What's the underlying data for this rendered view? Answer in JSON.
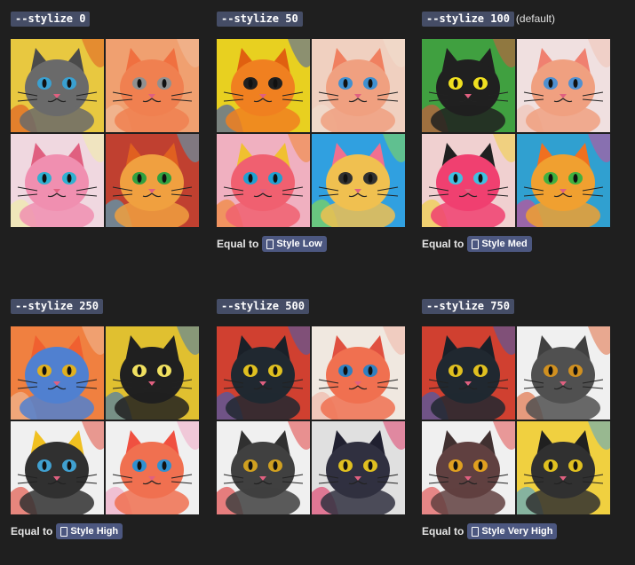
{
  "panels": [
    {
      "command": "--stylize 0",
      "note": "",
      "equal_prefix": "",
      "style": "",
      "palettes": [
        {
          "bg": "#e8c840",
          "face": "#6a6a6a",
          "ear": "#4a4a4a",
          "eye": "#3aa0d0",
          "accent": "#e05020"
        },
        {
          "bg": "#f0a070",
          "face": "#f08050",
          "ear": "#f07040",
          "eye": "#909090",
          "accent": "#f0c0a0"
        },
        {
          "bg": "#f0d8e0",
          "face": "#f08fb0",
          "ear": "#e06080",
          "eye": "#30b0d0",
          "accent": "#f0f0a0"
        },
        {
          "bg": "#c04030",
          "face": "#f0a040",
          "ear": "#e06020",
          "eye": "#30a040",
          "accent": "#40b0d0"
        }
      ]
    },
    {
      "command": "--stylize 50",
      "note": "",
      "equal_prefix": "Equal to",
      "style": "Style Low",
      "palettes": [
        {
          "bg": "#e8d020",
          "face": "#f08020",
          "ear": "#e06010",
          "eye": "#202020",
          "accent": "#3050c0"
        },
        {
          "bg": "#f0d0c0",
          "face": "#f0a080",
          "ear": "#f08060",
          "eye": "#4090d0",
          "accent": "#f0e0d0"
        },
        {
          "bg": "#f0b0c0",
          "face": "#f06070",
          "ear": "#f0c030",
          "eye": "#20a0d0",
          "accent": "#f08020"
        },
        {
          "bg": "#30a0e0",
          "face": "#f0c050",
          "ear": "#f07090",
          "eye": "#303030",
          "accent": "#90e040"
        }
      ]
    },
    {
      "command": "--stylize 100",
      "note": "(default)",
      "equal_prefix": "Equal to",
      "style": "Style Med",
      "palettes": [
        {
          "bg": "#40a040",
          "face": "#202020",
          "ear": "#202020",
          "eye": "#f0e020",
          "accent": "#e05040"
        },
        {
          "bg": "#f0e0e0",
          "face": "#f0a080",
          "ear": "#f08070",
          "eye": "#5090d0",
          "accent": "#f0c0b0"
        },
        {
          "bg": "#f0d0d0",
          "face": "#f04070",
          "ear": "#202020",
          "eye": "#40c0e0",
          "accent": "#f0d030"
        },
        {
          "bg": "#30a0d0",
          "face": "#f0a030",
          "ear": "#f07020",
          "eye": "#40b040",
          "accent": "#e04090"
        }
      ]
    },
    {
      "command": "--stylize 250",
      "note": "",
      "equal_prefix": "Equal to",
      "style": "Style High",
      "palettes": [
        {
          "bg": "#f08040",
          "face": "#5080d0",
          "ear": "#f06030",
          "eye": "#e0b020",
          "accent": "#f0c0a0"
        },
        {
          "bg": "#e0c030",
          "face": "#202020",
          "ear": "#202020",
          "eye": "#f0e060",
          "accent": "#3070c0"
        },
        {
          "bg": "#f0f0f0",
          "face": "#303030",
          "ear": "#f0c020",
          "eye": "#40a0d0",
          "accent": "#e04030"
        },
        {
          "bg": "#f0f0f0",
          "face": "#f07050",
          "ear": "#f05040",
          "eye": "#3090d0",
          "accent": "#f0a0c0"
        }
      ]
    },
    {
      "command": "--stylize 500",
      "note": "",
      "equal_prefix": "",
      "style": "",
      "palettes": [
        {
          "bg": "#d04030",
          "face": "#202830",
          "ear": "#1a2028",
          "eye": "#e0c020",
          "accent": "#3060c0"
        },
        {
          "bg": "#f0e8e0",
          "face": "#f07050",
          "ear": "#e05040",
          "eye": "#3080c0",
          "accent": "#f0b0a0"
        },
        {
          "bg": "#f0f0f0",
          "face": "#404040",
          "ear": "#303030",
          "eye": "#d0a020",
          "accent": "#e03030"
        },
        {
          "bg": "#e0e0e0",
          "face": "#303040",
          "ear": "#202030",
          "eye": "#e0c020",
          "accent": "#e03060"
        }
      ]
    },
    {
      "command": "--stylize 750",
      "note": "",
      "equal_prefix": "Equal to",
      "style": "Style Very High",
      "palettes": [
        {
          "bg": "#d04030",
          "face": "#202830",
          "ear": "#1a2028",
          "eye": "#e0c020",
          "accent": "#3060c0"
        },
        {
          "bg": "#f0f0f0",
          "face": "#505050",
          "ear": "#404040",
          "eye": "#d09020",
          "accent": "#e06030"
        },
        {
          "bg": "#f0f0f0",
          "face": "#604040",
          "ear": "#403030",
          "eye": "#e0a020",
          "accent": "#e04040"
        },
        {
          "bg": "#f0d040",
          "face": "#303030",
          "ear": "#202020",
          "eye": "#e0c020",
          "accent": "#40a0e0"
        }
      ]
    }
  ]
}
